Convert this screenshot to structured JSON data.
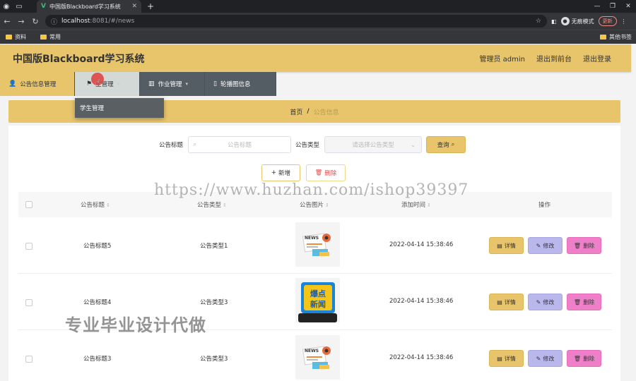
{
  "browser": {
    "tab_title": "中国版Blackboard学习系统",
    "url_host": "localhost",
    "url_path": ":8081/#/news",
    "incognito_label": "无痕模式",
    "update_label": "更新",
    "bookmarks": [
      "资料",
      "常用"
    ],
    "other_bookmarks": "其他书签"
  },
  "header": {
    "title": "中国版Blackboard学习系统",
    "user": "管理员 admin",
    "to_front": "退出到前台",
    "logout": "退出登录"
  },
  "nav": {
    "items": [
      {
        "label": "公告信息管理"
      },
      {
        "label": "生管理"
      },
      {
        "label": "作业管理"
      },
      {
        "label": "轮播图信息"
      }
    ],
    "dropdown_item": "学生管理"
  },
  "breadcrumb": {
    "home": "首页",
    "separator": "/",
    "current": "公告信息"
  },
  "search": {
    "title_label": "公告标题",
    "title_placeholder": "公告标题",
    "type_label": "公告类型",
    "type_placeholder": "请选择公告类型",
    "query_label": "查询"
  },
  "actions": {
    "add_label": "新增",
    "delete_label": "删除"
  },
  "table": {
    "columns": [
      "公告标题",
      "公告类型",
      "公告图片",
      "添加时间",
      "操作"
    ],
    "rows": [
      {
        "title": "公告标题5",
        "type": "公告类型1",
        "time": "2022-04-14 15:38:46",
        "image": "news-clip"
      },
      {
        "title": "公告标题4",
        "type": "公告类型3",
        "time": "2022-04-14 15:38:46",
        "image": "hot-news-phone"
      },
      {
        "title": "公告标题3",
        "type": "公告类型3",
        "time": "2022-04-14 15:38:46",
        "image": "news-clip"
      }
    ],
    "btn_detail": "详情",
    "btn_edit": "修改",
    "btn_delete": "删除"
  },
  "thumb_text": {
    "news_word": "NEWS",
    "hot_line1": "爆点",
    "hot_line2": "新闻"
  },
  "watermark": {
    "url": "https://www.huzhan.com/ishop39397",
    "slogan": "专业毕业设计代做"
  }
}
